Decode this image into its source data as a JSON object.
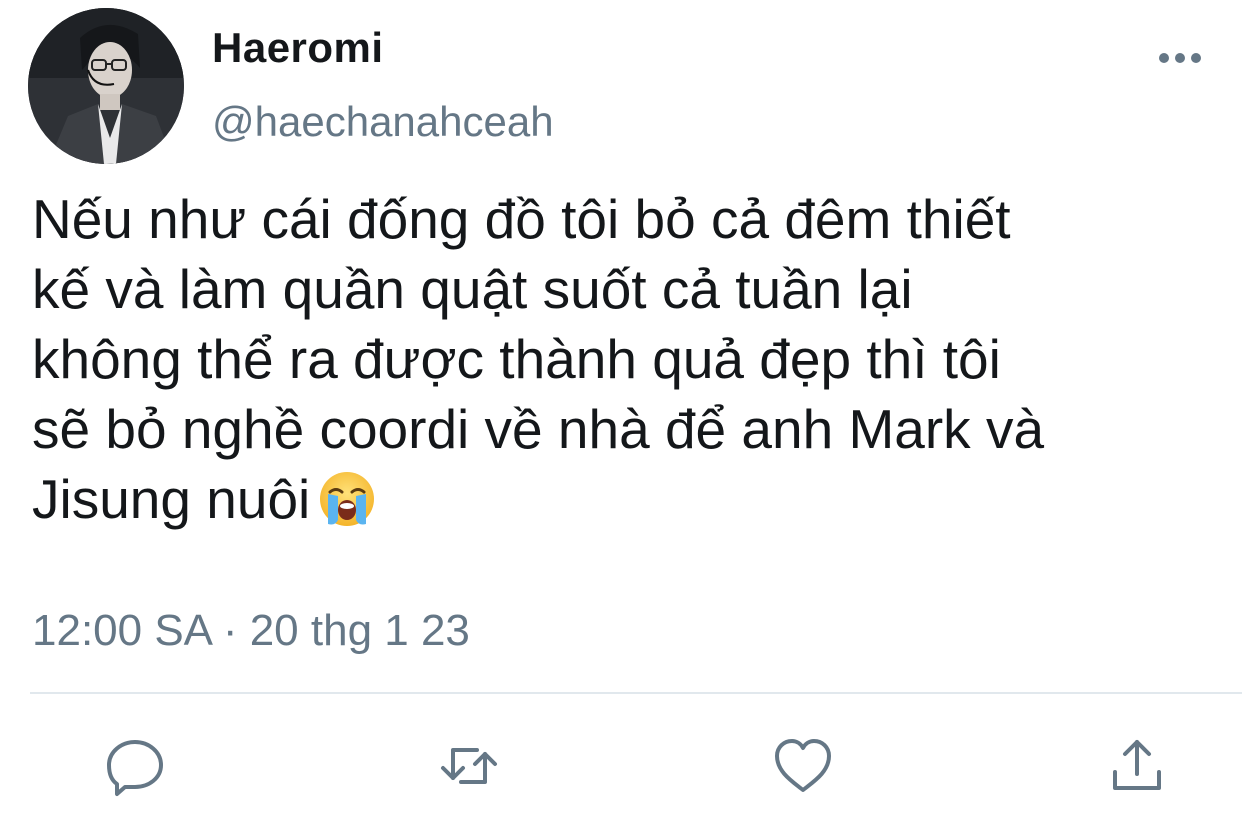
{
  "user": {
    "display_name": "Haeromi",
    "handle": "@haechanahceah",
    "avatar_icon": "avatar-photo"
  },
  "tweet": {
    "text": "Nếu như cái đống đồ tôi bỏ cả đêm thiết\nkế và làm quần quật suốt cả tuần lại\nkhông thể ra được thành quả đẹp thì tôi\nsẽ bỏ nghề coordi về nhà để anh Mark và\nJisung nuôi",
    "emoji": "loudly-crying-face",
    "timestamp": "12:00 SA · 20 thg 1 23"
  },
  "actions": {
    "more_icon": "more-dots-icon",
    "reply_icon": "reply-icon",
    "retweet_icon": "retweet-icon",
    "like_icon": "heart-icon",
    "share_icon": "share-icon"
  },
  "colors": {
    "text": "#14171a",
    "secondary": "#657786",
    "divider": "#e1e8ed",
    "icon": "#657786"
  }
}
